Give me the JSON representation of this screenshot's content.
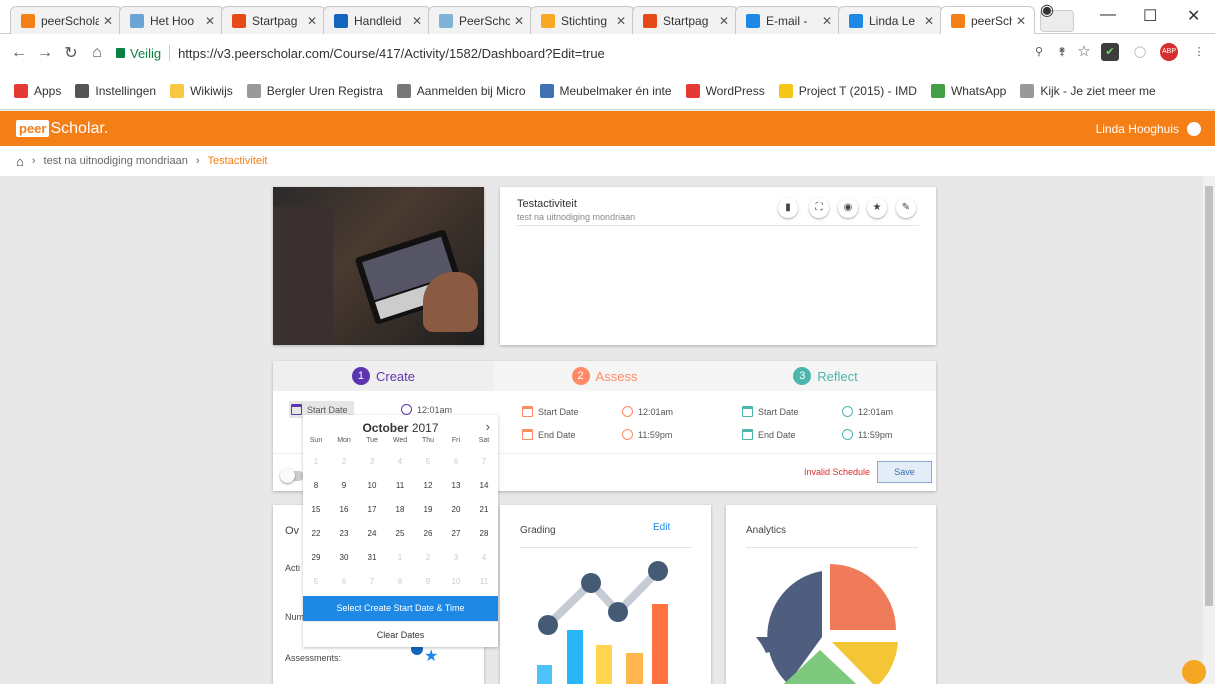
{
  "browser": {
    "tabs": [
      {
        "title": "peerScholar",
        "favicon_color": "#f57f17"
      },
      {
        "title": "Het Hoo",
        "favicon_color": "#6ba5d8"
      },
      {
        "title": "Startpag",
        "favicon_color": "#e64a19"
      },
      {
        "title": "Handleid",
        "favicon_color": "#1565c0"
      },
      {
        "title": "PeerScho",
        "favicon_color": "#7fb3d5"
      },
      {
        "title": "Stichting",
        "favicon_color": "#f9a825"
      },
      {
        "title": "Startpag",
        "favicon_color": "#e64a19"
      },
      {
        "title": "E-mail -",
        "favicon_color": "#1e88e5"
      },
      {
        "title": "Linda Le",
        "favicon_color": "#1e88e5"
      },
      {
        "title": "peerScho",
        "favicon_color": "#f57f17"
      }
    ],
    "secure_label": "Veilig",
    "url": "https://v3.peerscholar.com/Course/417/Activity/1582/Dashboard?Edit=true",
    "bookmarks": [
      {
        "label": "Apps",
        "icon": "apps-icon",
        "color": "#e53935"
      },
      {
        "label": "Instellingen",
        "icon": "gear-icon",
        "color": "#555555"
      },
      {
        "label": "Wikiwijs",
        "icon": "folder-icon",
        "color": "#f9c843"
      },
      {
        "label": "Bergler Uren Registra",
        "icon": "page-icon",
        "color": "#999999"
      },
      {
        "label": "Aanmelden bij Micro",
        "icon": "office-icon",
        "color": "#777777"
      },
      {
        "label": "Meubelmaker én inte",
        "icon": "store-icon",
        "color": "#3f6fb5"
      },
      {
        "label": "WordPress",
        "icon": "wordpress-icon",
        "color": "#e53935"
      },
      {
        "label": "Project T (2015) - IMD",
        "icon": "imdb-icon",
        "color": "#f5c518"
      },
      {
        "label": "WhatsApp",
        "icon": "whatsapp-icon",
        "color": "#43a047"
      },
      {
        "label": "Kijk - Je ziet meer me",
        "icon": "page-icon",
        "color": "#999999"
      }
    ]
  },
  "app": {
    "logo_box": "peer",
    "logo_rest": "Scholar.",
    "user_name": "Linda Hooghuis",
    "accent": "#f57f17"
  },
  "breadcrumb": {
    "course": "test na uitnodiging mondriaan",
    "current": "Testactiviteit"
  },
  "activity": {
    "title": "Testactiviteit",
    "subtitle": "test na uitnodiging mondriaan",
    "actions": [
      "trash-icon",
      "expand-icon",
      "visibility-icon",
      "star-icon",
      "edit-icon"
    ]
  },
  "phases": [
    {
      "num": "1",
      "label": "Create",
      "color": "#5e35b1"
    },
    {
      "num": "2",
      "label": "Assess",
      "color": "#ff8a65"
    },
    {
      "num": "3",
      "label": "Reflect",
      "color": "#4db6ac"
    }
  ],
  "schedule": {
    "start_label": "Start Date",
    "end_label": "End Date",
    "start_time": "12:01am",
    "end_time": "11:59pm",
    "invalid": "Invalid Schedule",
    "save": "Save"
  },
  "picker": {
    "month": "October",
    "year": "2017",
    "weekdays": [
      "Sun",
      "Mon",
      "Tue",
      "Wed",
      "Thu",
      "Fri",
      "Sat"
    ],
    "weeks": [
      [
        "1",
        "2",
        "3",
        "4",
        "5",
        "6",
        "7"
      ],
      [
        "8",
        "9",
        "10",
        "11",
        "12",
        "13",
        "14"
      ],
      [
        "15",
        "16",
        "17",
        "18",
        "19",
        "20",
        "21"
      ],
      [
        "22",
        "23",
        "24",
        "25",
        "26",
        "27",
        "28"
      ],
      [
        "29",
        "30",
        "31",
        "1",
        "2",
        "3",
        "4"
      ],
      [
        "5",
        "6",
        "7",
        "8",
        "9",
        "10",
        "11"
      ]
    ],
    "select_label": "Select Create Start Date & Time",
    "clear_label": "Clear Dates"
  },
  "overview": {
    "title": "Ov",
    "activity_label": "Acti",
    "number_label": "Num",
    "assessments_label": "Assessments:"
  },
  "grading": {
    "title": "Grading",
    "edit": "Edit"
  },
  "analytics": {
    "title": "Analytics"
  }
}
